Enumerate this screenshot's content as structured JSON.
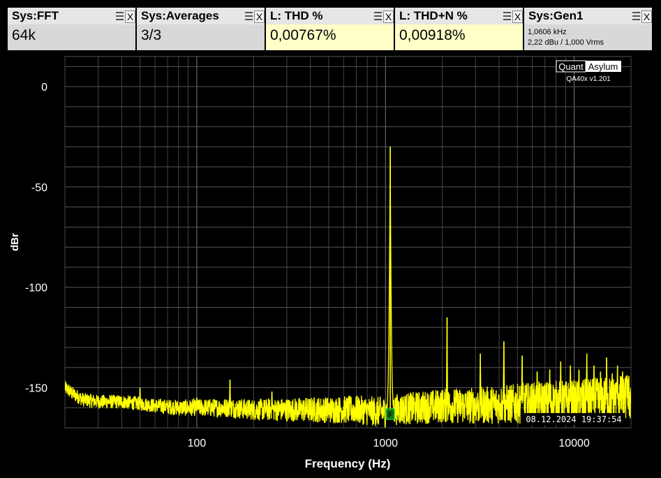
{
  "widgets": [
    {
      "title": "Sys:FFT",
      "value": "64k",
      "style": "grey"
    },
    {
      "title": "Sys:Averages",
      "value": "3/3",
      "style": "grey"
    },
    {
      "title": "L: THD %",
      "value": "0,00767%",
      "style": "yellow"
    },
    {
      "title": "L: THD+N %",
      "value": "0,00918%",
      "style": "yellow"
    },
    {
      "title": "Sys:Gen1",
      "line1": "1,0606 kHz",
      "line2": "2,22 dBu  / 1,000 Vrms",
      "style": "grey"
    }
  ],
  "widget_icons": {
    "menu": "menu-icon",
    "close": "close-icon",
    "close_glyph": "X"
  },
  "branding": {
    "logo_left": "Quant",
    "logo_right": "Asylum",
    "version": "QA40x v1.201"
  },
  "timestamp": "08.12.2024 19:37:54",
  "fundamental_marker": "F",
  "colors": {
    "trace": "#ffff00",
    "grid": "#555555",
    "plot_bg": "#000000",
    "text": "#ffffff",
    "marker": "#1a6e1a"
  },
  "chart_data": {
    "type": "line",
    "title": "",
    "xlabel": "Frequency (Hz)",
    "ylabel": "dBr",
    "xscale": "log",
    "xlim": [
      20,
      20000
    ],
    "ylim": [
      -170,
      15
    ],
    "yticks": [
      0,
      -50,
      -100,
      -150
    ],
    "xticks": [
      100,
      1000,
      10000
    ],
    "xtick_labels": [
      "100",
      "1000",
      "10000"
    ],
    "grid": true,
    "series": [
      {
        "color": "#ffff00",
        "noise_floor": [
          [
            20,
            -150
          ],
          [
            22,
            -153
          ],
          [
            25,
            -156
          ],
          [
            30,
            -157
          ],
          [
            40,
            -157
          ],
          [
            50,
            -158
          ],
          [
            60,
            -159
          ],
          [
            80,
            -160
          ],
          [
            100,
            -160
          ],
          [
            150,
            -160
          ],
          [
            200,
            -161
          ],
          [
            300,
            -161
          ],
          [
            500,
            -161
          ],
          [
            700,
            -161
          ],
          [
            900,
            -162
          ],
          [
            1000,
            -162
          ],
          [
            1100,
            -161
          ],
          [
            1500,
            -160
          ],
          [
            2000,
            -159
          ],
          [
            3000,
            -159
          ],
          [
            5000,
            -158
          ],
          [
            7000,
            -157
          ],
          [
            10000,
            -157
          ],
          [
            15000,
            -156
          ],
          [
            20000,
            -155
          ]
        ],
        "peaks": [
          {
            "x": 50,
            "y": -150
          },
          {
            "x": 100,
            "y": -155
          },
          {
            "x": 150,
            "y": -146
          },
          {
            "x": 250,
            "y": -152
          },
          {
            "x": 1060,
            "y": -30
          },
          {
            "x": 2121,
            "y": -115
          },
          {
            "x": 3182,
            "y": -133
          },
          {
            "x": 4242,
            "y": -127
          },
          {
            "x": 5303,
            "y": -134
          },
          {
            "x": 6364,
            "y": -142
          },
          {
            "x": 7424,
            "y": -141
          },
          {
            "x": 8485,
            "y": -137
          },
          {
            "x": 9545,
            "y": -139
          },
          {
            "x": 10606,
            "y": -141
          },
          {
            "x": 11667,
            "y": -133
          },
          {
            "x": 12727,
            "y": -139
          },
          {
            "x": 13788,
            "y": -142
          },
          {
            "x": 14848,
            "y": -135
          },
          {
            "x": 15909,
            "y": -143
          },
          {
            "x": 16970,
            "y": -139
          },
          {
            "x": 18030,
            "y": -142
          },
          {
            "x": 19091,
            "y": -144
          }
        ]
      }
    ]
  }
}
